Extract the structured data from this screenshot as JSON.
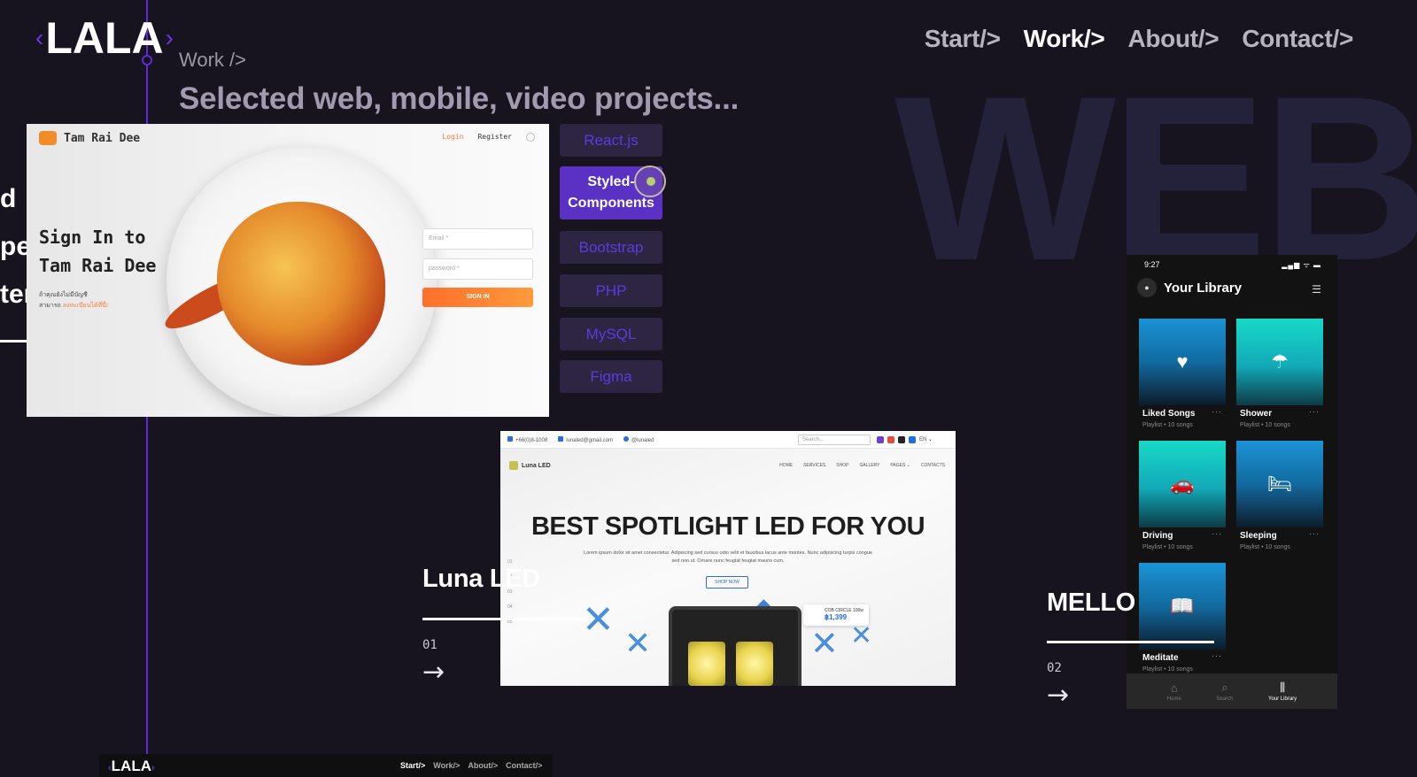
{
  "brand": {
    "logo_text": "LALA",
    "bracket_left": "‹",
    "bracket_right": "›"
  },
  "nav": {
    "items": [
      {
        "label": "Start/>",
        "active": false
      },
      {
        "label": "Work/>",
        "active": true
      },
      {
        "label": "About/>",
        "active": false
      },
      {
        "label": "Contact/>",
        "active": false
      }
    ]
  },
  "header": {
    "breadcrumb": "Work />",
    "subtitle": "Selected web, mobile, video projects...",
    "background_word": "WEB"
  },
  "cut_text": [
    "d",
    "pe",
    "ter"
  ],
  "project_tam": {
    "site_name": "Tam Rai Dee",
    "login": "Login",
    "register": "Register",
    "title_line1": "Sign In to",
    "title_line2": "Tam Rai Dee",
    "small_line1": "ถ้าคุณยังไม่มีบัญชี",
    "small_line2_prefix": "สามารถ",
    "small_line2_link": "ลงทะเบียนได้ที่นี่!",
    "email_placeholder": "Email *",
    "password_placeholder": "password *",
    "signin_button": "SIGN IN"
  },
  "tags": [
    {
      "label": "React.js",
      "active": false
    },
    {
      "label": "Styled-Components",
      "line1": "Styled-",
      "line2": "Components",
      "active": true
    },
    {
      "label": "Bootstrap",
      "active": false
    },
    {
      "label": "PHP",
      "active": false
    },
    {
      "label": "MySQL",
      "active": false
    },
    {
      "label": "Figma",
      "active": false
    }
  ],
  "project_luna": {
    "title": "Luna LED",
    "number": "01",
    "arrow": "→",
    "phone": "+66(0)8-1008",
    "email": "lunaled@gmail.com",
    "line": "@lunaled",
    "search_placeholder": "Search...",
    "lang": "EN ⌄",
    "brand": "Luna LED",
    "menu": [
      "HOME",
      "SERVICES",
      "SHOP",
      "GALLERY",
      "PAGES ⌄",
      "CONTACTS"
    ],
    "hero": "BEST SPOTLIGHT LED FOR YOU",
    "lorem": "Lorem ipsum dolor sit amet consectetur. Adipiscing sed cursus odio velit et faucibus lacus ante montes. Nunc adipiscing turpis congue sed non ut. Ornare nunc feugiat feugiat mauris cum.",
    "shop_button": "SHOP NOW",
    "product_name": "COB CIRCLE 100w",
    "product_price": "฿1,399",
    "side_numbers": [
      "01",
      "02",
      "03",
      "04",
      "05"
    ]
  },
  "project_mello": {
    "title": "MELLO",
    "number": "02",
    "arrow": "→",
    "time": "9:27",
    "status_icons": "▂▄▆ ᯤ ▬",
    "header": "Your Library",
    "menu_icon": "☰",
    "tiles": [
      {
        "name": "Liked Songs",
        "sub": "Playlist • 10 songs",
        "icon": "♥"
      },
      {
        "name": "Shower",
        "sub": "Playlist • 10 songs",
        "icon": "☂"
      },
      {
        "name": "Driving",
        "sub": "Playlist • 10 songs",
        "icon": "🚗"
      },
      {
        "name": "Sleeping",
        "sub": "Playlist • 10 songs",
        "icon": "🛏"
      },
      {
        "name": "Meditate",
        "sub": "Playlist • 10 songs",
        "icon": "📖"
      }
    ],
    "dots": "···",
    "tabbar": [
      {
        "label": "Home",
        "icon": "⌂",
        "active": false
      },
      {
        "label": "Search",
        "icon": "⌕",
        "active": false
      },
      {
        "label": "Your Library",
        "icon": "⫼",
        "active": true
      }
    ]
  },
  "preview": {
    "logo": "LALA",
    "nav": [
      "Start/>",
      "Work/>",
      "About/>",
      "Contact/>"
    ]
  },
  "colors": {
    "background": "#17131f",
    "accent": "#5b2bd6",
    "tag_bg": "#2d2542",
    "tag_active": "#5a31c2"
  }
}
